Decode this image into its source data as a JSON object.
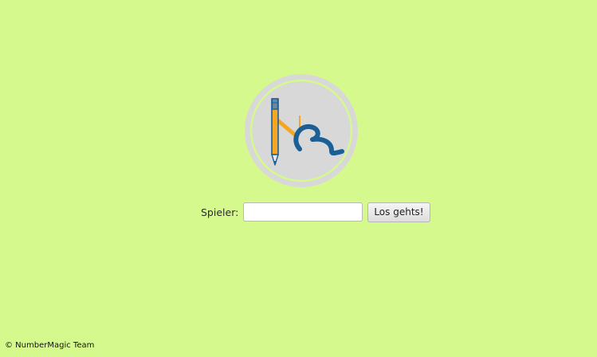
{
  "login": {
    "label": "Spieler:",
    "input_value": "",
    "input_placeholder": "",
    "button_label": "Los gehts!"
  },
  "logo": {
    "icon": "numbermagic-logo-icon",
    "ring_color": "#d9d9d9",
    "accent_orange": "#f5a623",
    "accent_blue": "#1a5f96"
  },
  "footer": {
    "text": "© NumberMagic Team"
  }
}
